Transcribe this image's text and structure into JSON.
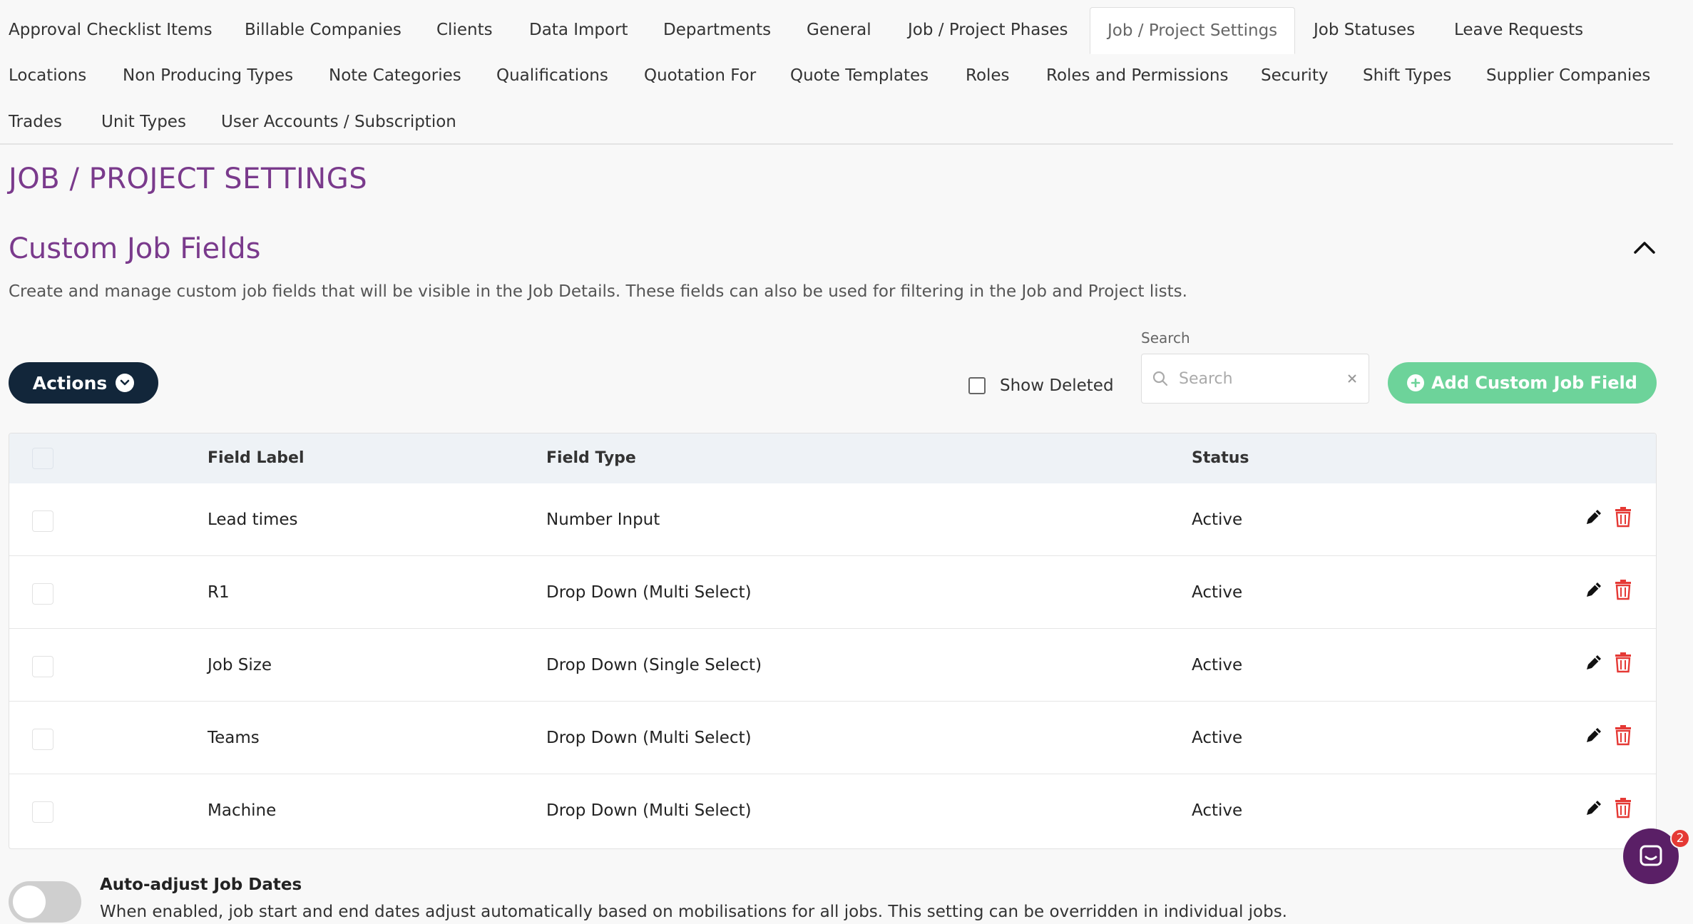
{
  "tabs": [
    {
      "label": "Approval Checklist Items"
    },
    {
      "label": "Billable Companies"
    },
    {
      "label": "Clients"
    },
    {
      "label": "Data Import"
    },
    {
      "label": "Departments"
    },
    {
      "label": "General"
    },
    {
      "label": "Job / Project Phases"
    },
    {
      "label": "Job / Project Settings",
      "active": true
    },
    {
      "label": "Job Statuses"
    },
    {
      "label": "Leave Requests"
    },
    {
      "label": "Locations"
    },
    {
      "label": "Non Producing Types"
    },
    {
      "label": "Note Categories"
    },
    {
      "label": "Qualifications"
    },
    {
      "label": "Quotation For"
    },
    {
      "label": "Quote Templates"
    },
    {
      "label": "Roles"
    },
    {
      "label": "Roles and Permissions"
    },
    {
      "label": "Security"
    },
    {
      "label": "Shift Types"
    },
    {
      "label": "Supplier Companies"
    },
    {
      "label": "Trades"
    },
    {
      "label": "Unit Types"
    },
    {
      "label": "User Accounts / Subscription"
    }
  ],
  "page": {
    "title": "JOB / PROJECT SETTINGS"
  },
  "section": {
    "title": "Custom Job Fields",
    "description": "Create and manage custom job fields that will be visible in the Job Details. These fields can also be used for filtering in the Job and Project lists."
  },
  "toolbar": {
    "actions_label": "Actions",
    "show_deleted_label": "Show Deleted",
    "show_deleted_checked": false,
    "search_label": "Search",
    "search_placeholder": "Search",
    "add_label": "Add Custom Job Field"
  },
  "table": {
    "columns": [
      "Field Label",
      "Field Type",
      "Status"
    ],
    "rows": [
      {
        "label": "Lead times",
        "type": "Number Input",
        "status": "Active"
      },
      {
        "label": "R1",
        "type": "Drop Down (Multi Select)",
        "status": "Active"
      },
      {
        "label": "Job Size",
        "type": "Drop Down (Single Select)",
        "status": "Active"
      },
      {
        "label": "Teams",
        "type": "Drop Down (Multi Select)",
        "status": "Active"
      },
      {
        "label": "Machine",
        "type": "Drop Down (Multi Select)",
        "status": "Active"
      }
    ]
  },
  "auto_adjust": {
    "title": "Auto-adjust Job Dates",
    "description": "When enabled, job start and end dates adjust automatically based on mobilisations for all jobs. This setting can be overridden in individual jobs.",
    "enabled": false
  },
  "chat": {
    "badge_count": "2"
  },
  "colors": {
    "accent_purple": "#7a3a8c",
    "actions_button": "#12263a",
    "add_button": "#6dd39a",
    "delete_icon": "#e53935",
    "chat_button": "#5a1f66"
  }
}
